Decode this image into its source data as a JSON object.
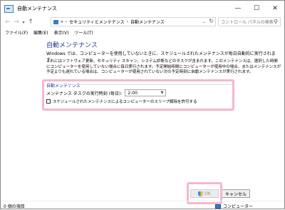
{
  "window": {
    "title": "自動メンテナンス",
    "minimize_icon": "minimize-icon",
    "maximize_icon": "maximize-icon",
    "close_icon": "close-icon"
  },
  "address_bar": {
    "breadcrumbs": [
      "«",
      "セキュリティとメンテナンス",
      "自動メンテナンス"
    ],
    "search_placeholder": "コントロール パネルの検索"
  },
  "menu": {
    "items": [
      "ファイル(F)",
      "編集(E)",
      "表示(V)",
      "ツール(T)"
    ]
  },
  "main": {
    "title": "自動メンテナンス",
    "intro": "Windows では、コンピューターを使用していないときに、スケジュールされたメンテナンスが毎日自動的に実行されます。",
    "description": "これにはソフトウェア更新、セキュリティ スキャン、システム診断などのタスクが含まれます。このメンテナンスは、選択した時間にコンピューターを使用していない場合に毎日実行されます。予定開始時間にコンピューターが使用中の場合、またはメンテナンスが予定よりも遅れている場合は、コンピューターが使用されていない次の予定時刻に自動メンテナンスが実行されます。",
    "section_title": "自動メンテナンス",
    "schedule_label": "メンテナンス タスクの実行時刻 (毎日):",
    "schedule_value": "2:00",
    "wake_checkbox_label": "スケジュールされたメンテナンスによるコンピューターのスリープ解除を許可する",
    "wake_checked": false
  },
  "buttons": {
    "ok": "OK",
    "cancel": "キャンセル"
  },
  "status_bar": {
    "item_count": "0 個の項目",
    "location": "コンピューター"
  },
  "colors": {
    "title_blue": "#1f3b9a",
    "highlight_pink": "#f3b7d1"
  }
}
